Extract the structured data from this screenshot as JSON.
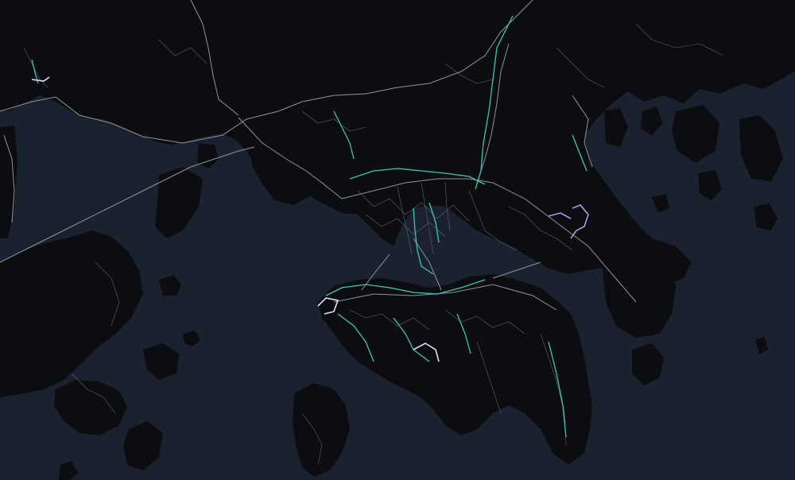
{
  "map": {
    "theme": "dark",
    "colors": {
      "water": "#19222e",
      "land": "#0b0d10",
      "land_texture": "#14171b",
      "road": "#8f959c",
      "road_minor": "#5f656c",
      "route": "#3fc6b6",
      "route_highlight": "#e8dcff",
      "route_alt": "#c9a8ff"
    },
    "labels": []
  }
}
